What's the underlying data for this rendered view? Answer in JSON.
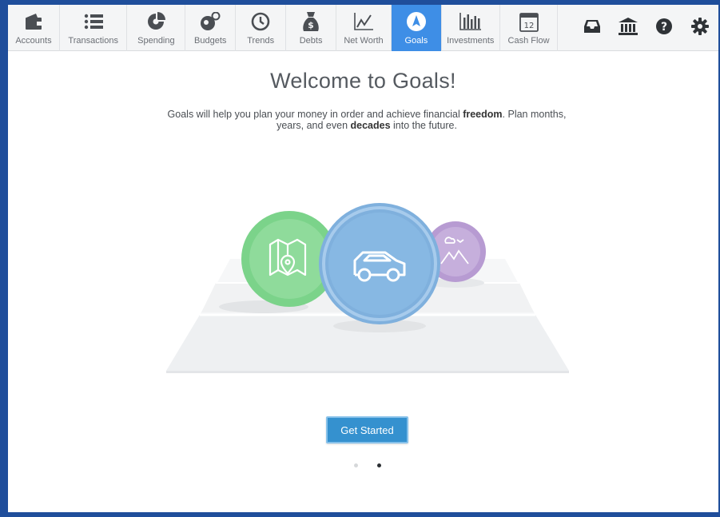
{
  "nav": {
    "items": [
      {
        "label": "Accounts",
        "icon": "wallet-icon"
      },
      {
        "label": "Transactions",
        "icon": "list-icon"
      },
      {
        "label": "Spending",
        "icon": "pie-chart-icon"
      },
      {
        "label": "Budgets",
        "icon": "coins-icon"
      },
      {
        "label": "Trends",
        "icon": "clock-icon"
      },
      {
        "label": "Debts",
        "icon": "money-bag-icon"
      },
      {
        "label": "Net Worth",
        "icon": "line-chart-icon"
      },
      {
        "label": "Goals",
        "icon": "compass-icon",
        "active": true
      },
      {
        "label": "Investments",
        "icon": "bar-chart-icon"
      },
      {
        "label": "Cash Flow",
        "icon": "calendar-icon",
        "calendar_day": "12"
      }
    ],
    "tools": [
      "inbox-icon",
      "bank-icon",
      "help-icon",
      "gear-icon"
    ]
  },
  "main": {
    "title": "Welcome to Goals!",
    "desc_part1": "Goals will help you plan your money in order and achieve financial ",
    "desc_bold1": "freedom",
    "desc_part2": ". Plan months, years, and even ",
    "desc_bold2": "decades",
    "desc_part3": " into the future.",
    "cta_label": "Get Started",
    "pager": {
      "total": 2,
      "current": 2
    }
  },
  "colors": {
    "frame": "#1f4e9b",
    "active_tab": "#3e8ee6",
    "cta": "#3591cf",
    "circle_green": "#7bd38a",
    "circle_blue": "#7fb0dd",
    "circle_purple": "#b79bd2"
  }
}
